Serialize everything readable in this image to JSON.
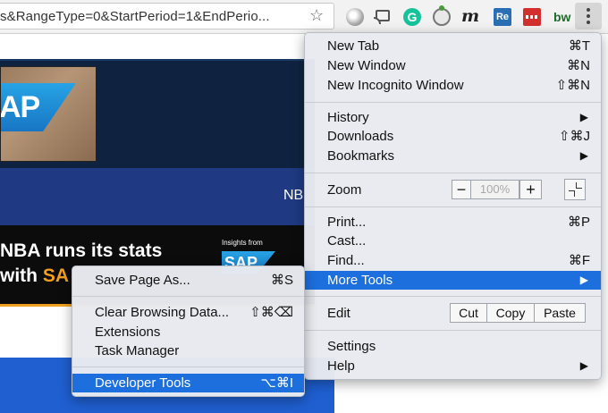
{
  "toolbar": {
    "url_text": "s&RangeType=0&StartPeriod=1&EndPerio...",
    "extensions": [
      "record-icon",
      "cast-icon",
      "grammarly-icon",
      "tomato-icon",
      "m-icon",
      "re-icon",
      "red-dots-icon",
      "bw-icon"
    ],
    "ext_g": "G",
    "ext_m": "m",
    "ext_re": "Re",
    "ext_bw": "bw"
  },
  "page": {
    "thumb_logo": "AP",
    "nav_text": "NB",
    "banner_line1": "NBA runs its stats",
    "banner_line2_prefix": "with ",
    "banner_line2_highlight": "SA",
    "insights_label": "Insights from",
    "sponsor_logo": "SAP"
  },
  "main_menu": {
    "new_tab": {
      "label": "New Tab",
      "shortcut": "⌘T"
    },
    "new_window": {
      "label": "New Window",
      "shortcut": "⌘N"
    },
    "new_incognito": {
      "label": "New Incognito Window",
      "shortcut": "⇧⌘N"
    },
    "history": {
      "label": "History"
    },
    "downloads": {
      "label": "Downloads",
      "shortcut": "⇧⌘J"
    },
    "bookmarks": {
      "label": "Bookmarks"
    },
    "zoom": {
      "label": "Zoom",
      "minus": "−",
      "value": "100%",
      "plus": "+"
    },
    "print": {
      "label": "Print...",
      "shortcut": "⌘P"
    },
    "cast": {
      "label": "Cast..."
    },
    "find": {
      "label": "Find...",
      "shortcut": "⌘F"
    },
    "more_tools": {
      "label": "More Tools"
    },
    "edit": {
      "label": "Edit",
      "cut": "Cut",
      "copy": "Copy",
      "paste": "Paste"
    },
    "settings": {
      "label": "Settings"
    },
    "help": {
      "label": "Help"
    },
    "arrow": "▶"
  },
  "sub_menu": {
    "save_page": {
      "label": "Save Page As...",
      "shortcut": "⌘S"
    },
    "clear_data": {
      "label": "Clear Browsing Data...",
      "shortcut": "⇧⌘⌫"
    },
    "extensions": {
      "label": "Extensions"
    },
    "task_manager": {
      "label": "Task Manager"
    },
    "developer_tools": {
      "label": "Developer Tools",
      "shortcut": "⌥⌘I"
    }
  },
  "colors": {
    "highlight": "#1c6fdd",
    "page_navy": "#0f2340",
    "page_blue": "#1f3a82",
    "accent_orange": "#f0a01e"
  }
}
